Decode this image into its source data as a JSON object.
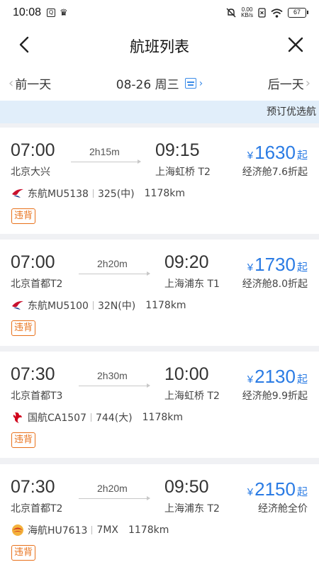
{
  "status_bar": {
    "time": "10:08",
    "notif_icon_label": "Q",
    "net_speed_top": "0.00",
    "net_speed_bottom": "KB/s",
    "battery": "67"
  },
  "header": {
    "title": "航班列表"
  },
  "date_bar": {
    "prev_label": "前一天",
    "date_label": "08-26 周三",
    "next_label": "后一天"
  },
  "notice": {
    "text": "预订优选航"
  },
  "flights": [
    {
      "dep_time": "07:00",
      "dep_airport": "北京大兴",
      "duration": "2h15m",
      "arr_time": "09:15",
      "arr_airport": "上海虹桥 T2",
      "currency": "¥",
      "price": "1630",
      "price_suffix": "起",
      "cabin": "经济舱7.6折起",
      "airline_flight": "东航MU5138",
      "aircraft": "325(中)",
      "distance": "1178km",
      "airline_logo": "china-eastern-logo",
      "logo_color": "#c8102e",
      "tag": "违背"
    },
    {
      "dep_time": "07:00",
      "dep_airport": "北京首都T2",
      "duration": "2h20m",
      "arr_time": "09:20",
      "arr_airport": "上海浦东 T1",
      "currency": "¥",
      "price": "1730",
      "price_suffix": "起",
      "cabin": "经济舱8.0折起",
      "airline_flight": "东航MU5100",
      "aircraft": "32N(中)",
      "distance": "1178km",
      "airline_logo": "china-eastern-logo",
      "logo_color": "#c8102e",
      "tag": "违背"
    },
    {
      "dep_time": "07:30",
      "dep_airport": "北京首都T3",
      "duration": "2h30m",
      "arr_time": "10:00",
      "arr_airport": "上海虹桥 T2",
      "currency": "¥",
      "price": "2130",
      "price_suffix": "起",
      "cabin": "经济舱9.9折起",
      "airline_flight": "国航CA1507",
      "aircraft": "744(大)",
      "distance": "1178km",
      "airline_logo": "air-china-logo",
      "logo_color": "#d0021b",
      "tag": "违背"
    },
    {
      "dep_time": "07:30",
      "dep_airport": "北京首都T2",
      "duration": "2h20m",
      "arr_time": "09:50",
      "arr_airport": "上海浦东 T2",
      "currency": "¥",
      "price": "2150",
      "price_suffix": "起",
      "cabin": "经济舱全价",
      "airline_flight": "海航HU7613",
      "aircraft": "7MX",
      "distance": "1178km",
      "airline_logo": "hainan-airlines-logo",
      "logo_color": "#e0502a",
      "tag": "违背"
    }
  ],
  "colors": {
    "accent": "#2a7be4",
    "tag": "#e8701a",
    "notice_bg": "#e1eefa"
  }
}
